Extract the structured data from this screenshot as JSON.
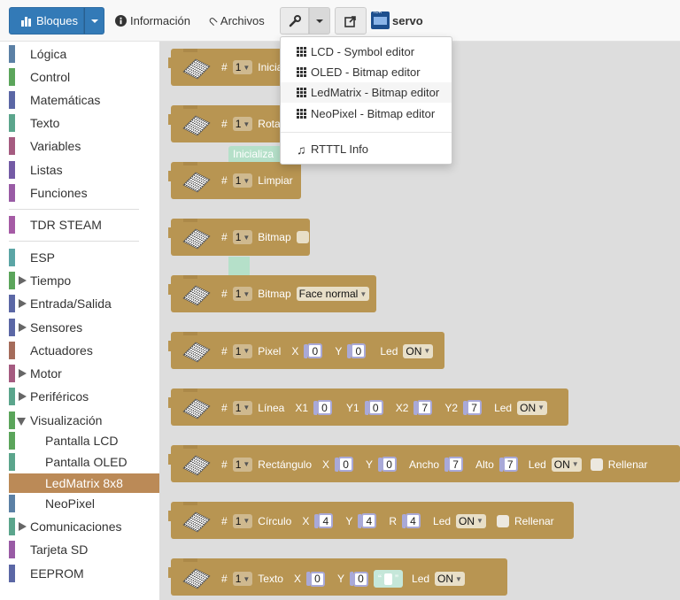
{
  "toolbar": {
    "blocks_label": "Bloques",
    "info_label": "Información",
    "files_label": "Archivos",
    "project_name": "servo",
    "board_logo_text": "TDR"
  },
  "tools_menu": {
    "items": [
      {
        "label": "LCD - Symbol editor"
      },
      {
        "label": "OLED - Bitmap editor"
      },
      {
        "label": "LedMatrix - Bitmap editor"
      },
      {
        "label": "NeoPixel - Bitmap editor"
      },
      {
        "label": "RTTTL Info"
      }
    ]
  },
  "sidebar": {
    "categories": [
      {
        "label": "Lógica",
        "color": "#5b80a5"
      },
      {
        "label": "Control",
        "color": "#5ba55b"
      },
      {
        "label": "Matemáticas",
        "color": "#5b67a5"
      },
      {
        "label": "Texto",
        "color": "#5ba58c"
      },
      {
        "label": "Variables",
        "color": "#a55b80"
      },
      {
        "label": "Listas",
        "color": "#745ba5"
      },
      {
        "label": "Funciones",
        "color": "#995ba5"
      },
      {
        "label": "TDR STEAM",
        "color": "#a55ba5"
      },
      {
        "label": "ESP",
        "color": "#5ba5a5"
      },
      {
        "label": "Tiempo",
        "color": "#5ba55b"
      },
      {
        "label": "Entrada/Salida",
        "color": "#5b67a5"
      },
      {
        "label": "Sensores",
        "color": "#5b67a5"
      },
      {
        "label": "Actuadores",
        "color": "#a56c5b"
      },
      {
        "label": "Motor",
        "color": "#a55b80"
      },
      {
        "label": "Periféricos",
        "color": "#5ba58c"
      },
      {
        "label": "Visualización",
        "color": "#5ba55b"
      },
      {
        "label": "Pantalla LCD",
        "color": "#5ba55b"
      },
      {
        "label": "Pantalla OLED",
        "color": "#5ba58c"
      },
      {
        "label": "LedMatrix 8x8",
        "color": "#bb8a57"
      },
      {
        "label": "NeoPixel",
        "color": "#5b80a5"
      },
      {
        "label": "Comunicaciones",
        "color": "#5ba58c"
      },
      {
        "label": "Tarjeta SD",
        "color": "#995ba5"
      },
      {
        "label": "EEPROM",
        "color": "#5b67a5"
      }
    ]
  },
  "blocks": {
    "hash": "#",
    "matrix_num": "1",
    "b1": {
      "label": "Inicial"
    },
    "b2": {
      "label": "Rota"
    },
    "ghost_label": "Inicializa",
    "b3": {
      "label": "Limpiar"
    },
    "b4": {
      "label": "Bitmap"
    },
    "b5": {
      "label": "Bitmap",
      "face": "Face normal"
    },
    "b6": {
      "label": "Pixel",
      "x_label": "X",
      "x": "0",
      "y_label": "Y",
      "y": "0",
      "led_label": "Led",
      "led": "ON"
    },
    "b7": {
      "label": "Línea",
      "x1_label": "X1",
      "x1": "0",
      "y1_label": "Y1",
      "y1": "0",
      "x2_label": "X2",
      "x2": "7",
      "y2_label": "Y2",
      "y2": "7",
      "led_label": "Led",
      "led": "ON"
    },
    "b8": {
      "label": "Rectángulo",
      "x_label": "X",
      "x": "0",
      "y_label": "Y",
      "y": "0",
      "w_label": "Ancho",
      "w": "7",
      "h_label": "Alto",
      "h": "7",
      "led_label": "Led",
      "led": "ON",
      "fill_label": "Rellenar"
    },
    "b9": {
      "label": "Círculo",
      "x_label": "X",
      "x": "4",
      "y_label": "Y",
      "y": "4",
      "r_label": "R",
      "r": "4",
      "led_label": "Led",
      "led": "ON",
      "fill_label": "Rellenar"
    },
    "b10": {
      "label": "Texto",
      "x_label": "X",
      "x": "0",
      "y_label": "Y",
      "y": "0",
      "quote_open": "“",
      "quote_close": "”",
      "led_label": "Led",
      "led": "ON"
    }
  }
}
